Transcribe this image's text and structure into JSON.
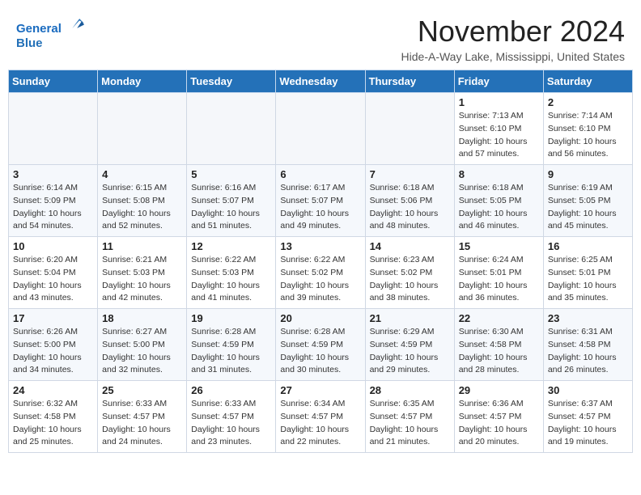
{
  "header": {
    "logo_line1": "General",
    "logo_line2": "Blue",
    "month": "November 2024",
    "location": "Hide-A-Way Lake, Mississippi, United States"
  },
  "weekdays": [
    "Sunday",
    "Monday",
    "Tuesday",
    "Wednesday",
    "Thursday",
    "Friday",
    "Saturday"
  ],
  "weeks": [
    [
      {
        "day": "",
        "info": ""
      },
      {
        "day": "",
        "info": ""
      },
      {
        "day": "",
        "info": ""
      },
      {
        "day": "",
        "info": ""
      },
      {
        "day": "",
        "info": ""
      },
      {
        "day": "1",
        "info": "Sunrise: 7:13 AM\nSunset: 6:10 PM\nDaylight: 10 hours\nand 57 minutes."
      },
      {
        "day": "2",
        "info": "Sunrise: 7:14 AM\nSunset: 6:10 PM\nDaylight: 10 hours\nand 56 minutes."
      }
    ],
    [
      {
        "day": "3",
        "info": "Sunrise: 6:14 AM\nSunset: 5:09 PM\nDaylight: 10 hours\nand 54 minutes."
      },
      {
        "day": "4",
        "info": "Sunrise: 6:15 AM\nSunset: 5:08 PM\nDaylight: 10 hours\nand 52 minutes."
      },
      {
        "day": "5",
        "info": "Sunrise: 6:16 AM\nSunset: 5:07 PM\nDaylight: 10 hours\nand 51 minutes."
      },
      {
        "day": "6",
        "info": "Sunrise: 6:17 AM\nSunset: 5:07 PM\nDaylight: 10 hours\nand 49 minutes."
      },
      {
        "day": "7",
        "info": "Sunrise: 6:18 AM\nSunset: 5:06 PM\nDaylight: 10 hours\nand 48 minutes."
      },
      {
        "day": "8",
        "info": "Sunrise: 6:18 AM\nSunset: 5:05 PM\nDaylight: 10 hours\nand 46 minutes."
      },
      {
        "day": "9",
        "info": "Sunrise: 6:19 AM\nSunset: 5:05 PM\nDaylight: 10 hours\nand 45 minutes."
      }
    ],
    [
      {
        "day": "10",
        "info": "Sunrise: 6:20 AM\nSunset: 5:04 PM\nDaylight: 10 hours\nand 43 minutes."
      },
      {
        "day": "11",
        "info": "Sunrise: 6:21 AM\nSunset: 5:03 PM\nDaylight: 10 hours\nand 42 minutes."
      },
      {
        "day": "12",
        "info": "Sunrise: 6:22 AM\nSunset: 5:03 PM\nDaylight: 10 hours\nand 41 minutes."
      },
      {
        "day": "13",
        "info": "Sunrise: 6:22 AM\nSunset: 5:02 PM\nDaylight: 10 hours\nand 39 minutes."
      },
      {
        "day": "14",
        "info": "Sunrise: 6:23 AM\nSunset: 5:02 PM\nDaylight: 10 hours\nand 38 minutes."
      },
      {
        "day": "15",
        "info": "Sunrise: 6:24 AM\nSunset: 5:01 PM\nDaylight: 10 hours\nand 36 minutes."
      },
      {
        "day": "16",
        "info": "Sunrise: 6:25 AM\nSunset: 5:01 PM\nDaylight: 10 hours\nand 35 minutes."
      }
    ],
    [
      {
        "day": "17",
        "info": "Sunrise: 6:26 AM\nSunset: 5:00 PM\nDaylight: 10 hours\nand 34 minutes."
      },
      {
        "day": "18",
        "info": "Sunrise: 6:27 AM\nSunset: 5:00 PM\nDaylight: 10 hours\nand 32 minutes."
      },
      {
        "day": "19",
        "info": "Sunrise: 6:28 AM\nSunset: 4:59 PM\nDaylight: 10 hours\nand 31 minutes."
      },
      {
        "day": "20",
        "info": "Sunrise: 6:28 AM\nSunset: 4:59 PM\nDaylight: 10 hours\nand 30 minutes."
      },
      {
        "day": "21",
        "info": "Sunrise: 6:29 AM\nSunset: 4:59 PM\nDaylight: 10 hours\nand 29 minutes."
      },
      {
        "day": "22",
        "info": "Sunrise: 6:30 AM\nSunset: 4:58 PM\nDaylight: 10 hours\nand 28 minutes."
      },
      {
        "day": "23",
        "info": "Sunrise: 6:31 AM\nSunset: 4:58 PM\nDaylight: 10 hours\nand 26 minutes."
      }
    ],
    [
      {
        "day": "24",
        "info": "Sunrise: 6:32 AM\nSunset: 4:58 PM\nDaylight: 10 hours\nand 25 minutes."
      },
      {
        "day": "25",
        "info": "Sunrise: 6:33 AM\nSunset: 4:57 PM\nDaylight: 10 hours\nand 24 minutes."
      },
      {
        "day": "26",
        "info": "Sunrise: 6:33 AM\nSunset: 4:57 PM\nDaylight: 10 hours\nand 23 minutes."
      },
      {
        "day": "27",
        "info": "Sunrise: 6:34 AM\nSunset: 4:57 PM\nDaylight: 10 hours\nand 22 minutes."
      },
      {
        "day": "28",
        "info": "Sunrise: 6:35 AM\nSunset: 4:57 PM\nDaylight: 10 hours\nand 21 minutes."
      },
      {
        "day": "29",
        "info": "Sunrise: 6:36 AM\nSunset: 4:57 PM\nDaylight: 10 hours\nand 20 minutes."
      },
      {
        "day": "30",
        "info": "Sunrise: 6:37 AM\nSunset: 4:57 PM\nDaylight: 10 hours\nand 19 minutes."
      }
    ]
  ]
}
